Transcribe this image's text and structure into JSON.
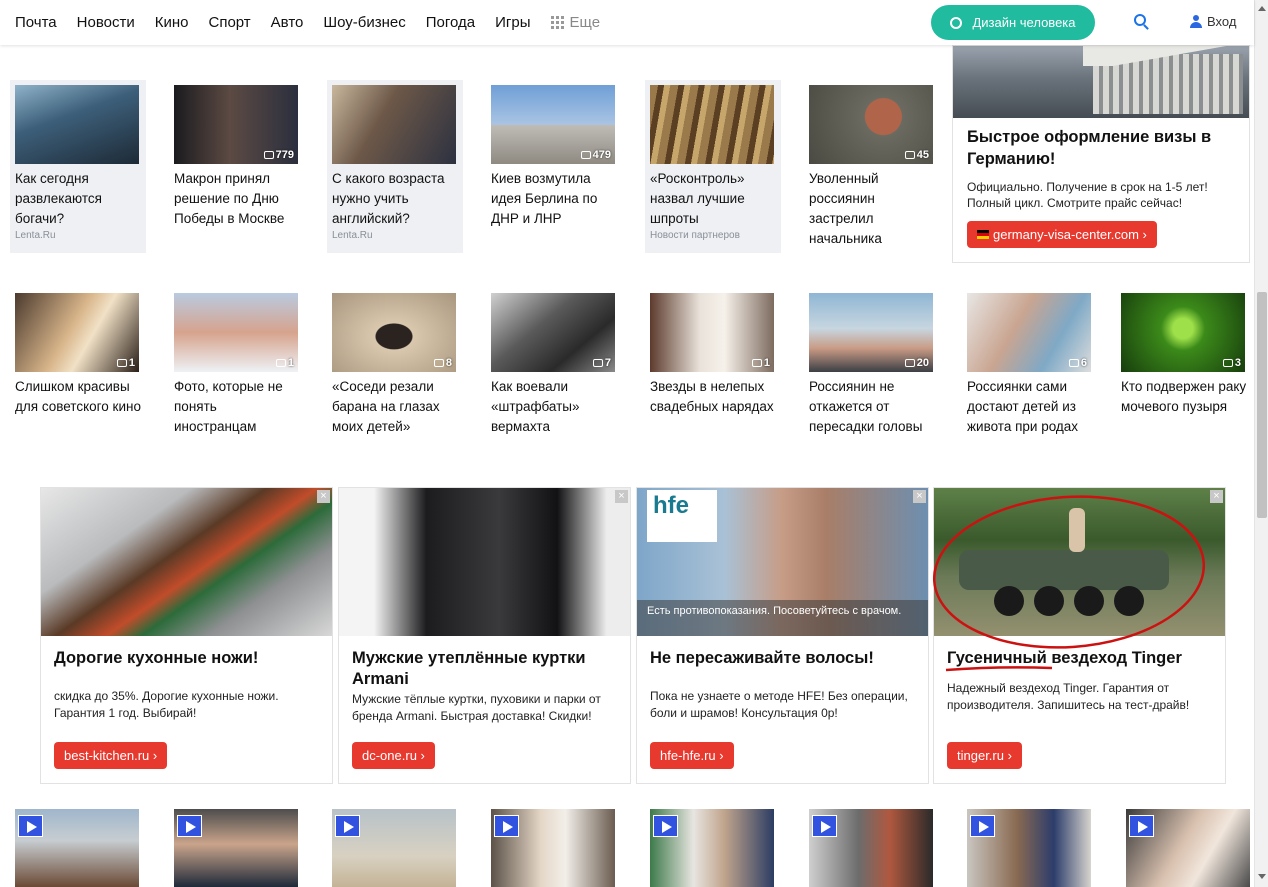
{
  "nav": {
    "items": [
      "Почта",
      "Новости",
      "Кино",
      "Спорт",
      "Авто",
      "Шоу-бизнес",
      "Погода",
      "Игры"
    ],
    "more": "Еще",
    "design_button": "Дизайн человека",
    "login": "Вход"
  },
  "news_row1": [
    {
      "title": "Как сегодня развлекаются богачи?",
      "source": "Lenta.Ru",
      "count": ""
    },
    {
      "title": "Макрон принял решение по Дню Победы в Москве",
      "source": "",
      "count": "779"
    },
    {
      "title": "С какого возраста нужно учить английский?",
      "source": "Lenta.Ru",
      "count": ""
    },
    {
      "title": "Киев возмутила идея Берлина по ДНР и ЛНР",
      "source": "",
      "count": "479"
    },
    {
      "title": "«Росконтроль» назвал лучшие шпроты",
      "source": "Новости партнеров",
      "count": ""
    },
    {
      "title": "Уволенный россиянин застрелил начальника",
      "source": "",
      "count": "45"
    }
  ],
  "ad_right": {
    "title": "Быстрое оформление визы в Германию!",
    "desc": "Официально. Получение в срок на 1-5 лет! Полный цикл. Смотрите прайс сейчас!",
    "link": "germany-visa-center.com ›"
  },
  "news_row2": [
    {
      "title": "Слишком красивы для советского кино",
      "count": "1"
    },
    {
      "title": "Фото, которые не понять иностранцам",
      "count": "1"
    },
    {
      "title": "«Соседи резали барана на глазах моих детей»",
      "count": "8"
    },
    {
      "title": "Как воевали «штрафбаты» вермахта",
      "count": "7"
    },
    {
      "title": "Звезды в нелепых свадебных нарядах",
      "count": "1"
    },
    {
      "title": "Россиянин не откажется от пересадки головы",
      "count": "20"
    },
    {
      "title": "Россиянки сами достают детей из живота при родах",
      "count": "6"
    },
    {
      "title": "Кто подвержен раку мочевого пузыря",
      "count": "3"
    }
  ],
  "ads": [
    {
      "title": "Дорогие кухонные ножи!",
      "desc": "скидка до 35%. Дорогие кухонные ножи. Гарантия 1 год. Выбирай!",
      "link": "best-kitchen.ru ›",
      "overlay": ""
    },
    {
      "title": "Мужские утеплённые куртки Armani",
      "desc": "Мужские тёплые куртки, пуховики и парки от бренда Armani. Быстрая доставка! Скидки!",
      "link": "dc-one.ru ›",
      "overlay": ""
    },
    {
      "title": "Не пересаживайте волосы!",
      "desc": "Пока не узнаете о методе HFE! Без операции, боли и шрамов! Консультация 0р!",
      "link": "hfe-hfe.ru ›",
      "overlay": "Есть противопоказания. Посоветуйтесь с врачом.",
      "logo": "hfe"
    },
    {
      "title": "Гусеничный вездеход Tinger",
      "desc": "Надежный вездеход Tinger. Гарантия от производителя. Запишитесь на тест-драйв!",
      "link": "tinger.ru ›",
      "overlay": ""
    }
  ],
  "colors": {
    "accent_green": "#21bba0",
    "ad_button_red": "#e8392f",
    "annotation_red": "#cc1111",
    "play_blue": "#3153e0"
  }
}
